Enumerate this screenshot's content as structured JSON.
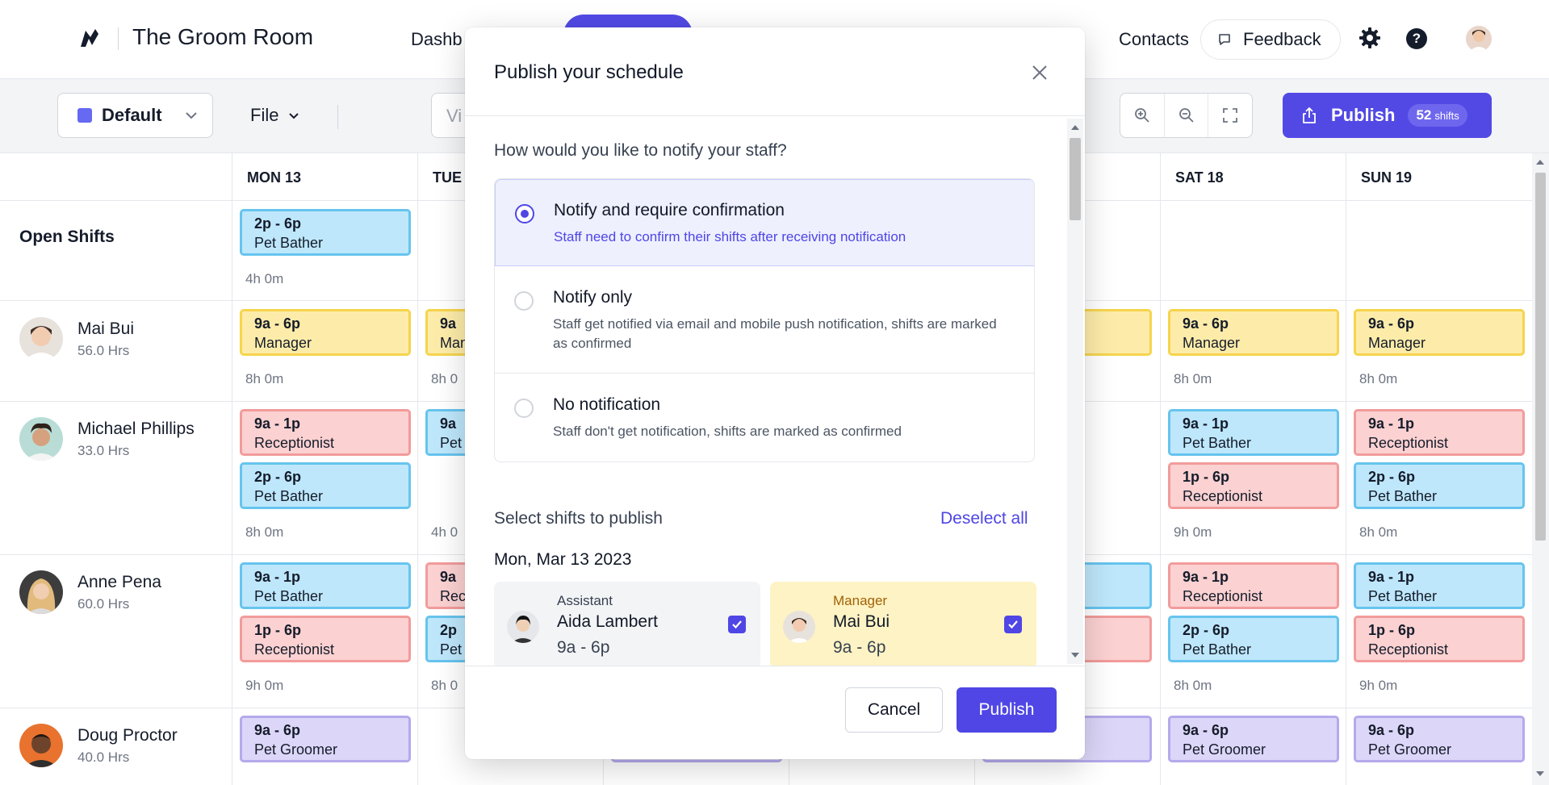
{
  "app": {
    "title": "The Groom Room"
  },
  "nav": {
    "dashboard": "Dashb",
    "contacts": "Contacts",
    "feedback": "Feedback",
    "help": "?"
  },
  "toolbar": {
    "default": "Default",
    "file": "File",
    "view_partial": "Vi",
    "publish": "Publish",
    "shift_count": "52",
    "shift_unit": "shifts"
  },
  "columns": {
    "mon": "MON 13",
    "tue": "TUE",
    "sat": "SAT 18",
    "sun": "SUN 19"
  },
  "rows": {
    "open": {
      "label": "Open Shifts",
      "mon": {
        "time": "2p - 6p",
        "role": "Pet Bather",
        "hours": "4h 0m"
      }
    },
    "mai": {
      "name": "Mai Bui",
      "hrs": "56.0 Hrs",
      "mon": {
        "time": "9a - 6p",
        "role": "Manager",
        "hours": "8h 0m"
      },
      "tue": {
        "time": "9a",
        "role": "Man",
        "hours": "8h 0"
      },
      "sat": {
        "time": "9a - 6p",
        "role": "Manager",
        "hours": "8h 0m"
      },
      "sun": {
        "time": "9a - 6p",
        "role": "Manager",
        "hours": "8h 0m"
      }
    },
    "michael": {
      "name": "Michael Phillips",
      "hrs": "33.0 Hrs",
      "mon1": {
        "time": "9a - 1p",
        "role": "Receptionist"
      },
      "mon2": {
        "time": "2p - 6p",
        "role": "Pet Bather"
      },
      "mon_hours": "8h 0m",
      "tue": {
        "time": "9a",
        "role": "Pet"
      },
      "tue_hours": "4h 0",
      "sat1": {
        "time": "9a - 1p",
        "role": "Pet Bather"
      },
      "sat2": {
        "time": "1p - 6p",
        "role": "Receptionist"
      },
      "sat_hours": "9h 0m",
      "sun1": {
        "time": "9a - 1p",
        "role": "Receptionist"
      },
      "sun2": {
        "time": "2p - 6p",
        "role": "Pet Bather"
      },
      "sun_hours": "8h 0m"
    },
    "anne": {
      "name": "Anne Pena",
      "hrs": "60.0 Hrs",
      "mon1": {
        "time": "9a - 1p",
        "role": "Pet Bather"
      },
      "mon2": {
        "time": "1p - 6p",
        "role": "Receptionist"
      },
      "mon_hours": "9h 0m",
      "tue1": {
        "time": "9a",
        "role": "Rec"
      },
      "tue2": {
        "time": "2p",
        "role": "Pet"
      },
      "tue_hours": "8h 0",
      "sat1": {
        "time": "9a - 1p",
        "role": "Receptionist"
      },
      "sat2": {
        "time": "2p - 6p",
        "role": "Pet Bather"
      },
      "sat_hours": "8h 0m",
      "sun1": {
        "time": "9a - 1p",
        "role": "Pet Bather"
      },
      "sun2": {
        "time": "1p - 6p",
        "role": "Receptionist"
      },
      "sun_hours": "9h 0m"
    },
    "doug": {
      "name": "Doug Proctor",
      "hrs": "40.0 Hrs",
      "mon": {
        "time": "9a - 6p",
        "role": "Pet Groomer"
      },
      "sat": {
        "time": "9a - 6p",
        "role": "Pet Groomer"
      },
      "sun": {
        "time": "9a - 6p",
        "role": "Pet Groomer"
      }
    }
  },
  "modal": {
    "title": "Publish your schedule",
    "question": "How would you like to notify your staff?",
    "options": [
      {
        "title": "Notify and require confirmation",
        "desc": "Staff need to confirm their shifts after receiving notification",
        "selected": true
      },
      {
        "title": "Notify only",
        "desc": "Staff get notified via email and mobile push notification, shifts are marked as confirmed",
        "selected": false
      },
      {
        "title": "No notification",
        "desc": "Staff don't get notification, shifts are marked as confirmed",
        "selected": false
      }
    ],
    "select_title": "Select shifts to publish",
    "deselect_all": "Deselect all",
    "date": "Mon, Mar 13 2023",
    "cards": [
      {
        "role": "Assistant",
        "name": "Aida Lambert",
        "time": "9a - 6p",
        "checked": true
      },
      {
        "role": "Manager",
        "name": "Mai Bui",
        "time": "9a - 6p",
        "checked": true
      }
    ],
    "cancel": "Cancel",
    "publish": "Publish"
  },
  "colors": {
    "accent": "#4f46e5",
    "blue": "#bde7fb",
    "yellow": "#fdeca8",
    "red": "#fbd1d1",
    "purple": "#dcd6f8"
  }
}
